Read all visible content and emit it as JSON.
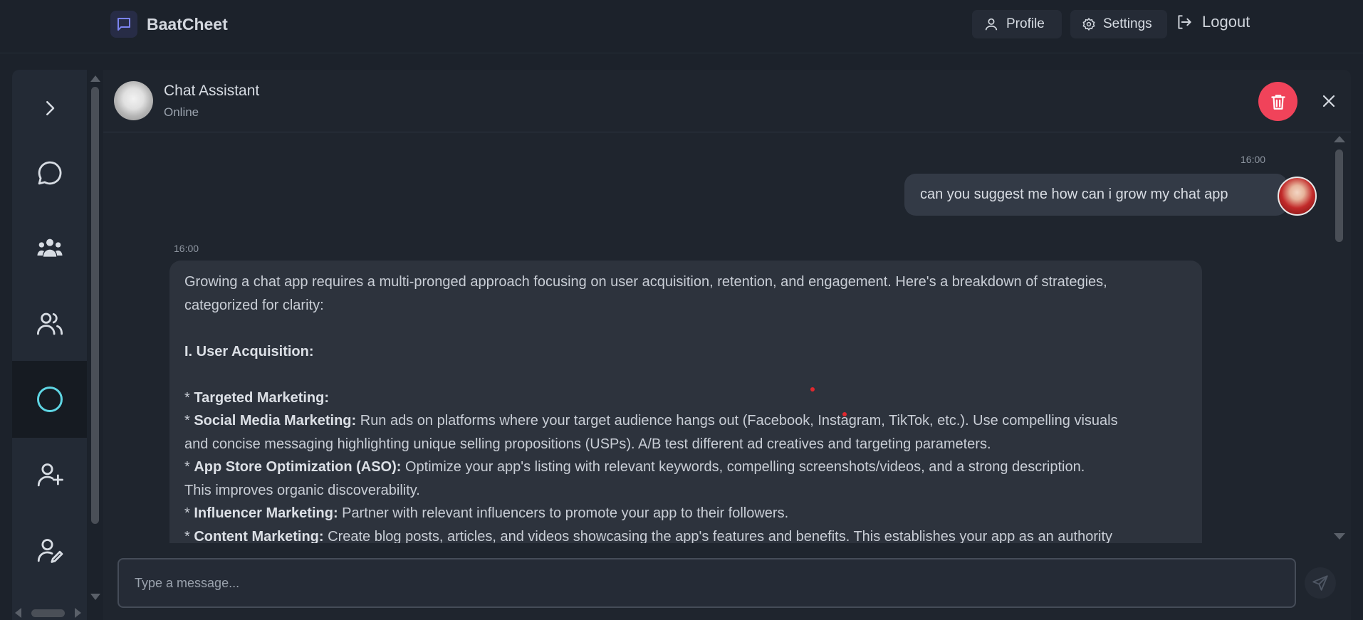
{
  "app": {
    "brand_name": "BaatCheet"
  },
  "nav": {
    "profile_label": "Profile",
    "settings_label": "Settings",
    "logout_label": "Logout"
  },
  "sidebar": {
    "items": [
      {
        "icon": "chevron-right-icon"
      },
      {
        "icon": "chat-bubble-icon"
      },
      {
        "icon": "group-icon"
      },
      {
        "icon": "users-icon"
      },
      {
        "icon": "circle-icon",
        "active": true
      },
      {
        "icon": "add-user-icon"
      },
      {
        "icon": "user-edit-icon"
      }
    ]
  },
  "chat": {
    "title": "Chat Assistant",
    "status": "Online",
    "messages": {
      "user_time": "16:00",
      "user_text": "can you suggest me how can i grow my chat app",
      "bot_time": "16:00",
      "bot_lines": [
        {
          "text": "Growing a chat app requires a multi-pronged approach focusing on user acquisition, retention, and engagement. Here's a breakdown of strategies,"
        },
        {
          "text": "categorized for clarity:"
        },
        {
          "text": ""
        },
        {
          "bold": "I. User Acquisition:"
        },
        {
          "text": ""
        },
        {
          "prefix": "* ",
          "bold": "Targeted Marketing:"
        },
        {
          "prefix": "* ",
          "bold": "Social Media Marketing:",
          "text": " Run ads on platforms where your target audience hangs out (Facebook, Instagram, TikTok, etc.). Use compelling visuals"
        },
        {
          "text": "and concise messaging highlighting unique selling propositions (USPs). A/B test different ad creatives and targeting parameters."
        },
        {
          "prefix": "* ",
          "bold": "App Store Optimization (ASO):",
          "text": " Optimize your app's listing with relevant keywords, compelling screenshots/videos, and a strong description."
        },
        {
          "text": "This improves organic discoverability."
        },
        {
          "prefix": "* ",
          "bold": "Influencer Marketing:",
          "text": " Partner with relevant influencers to promote your app to their followers."
        },
        {
          "prefix": "* ",
          "bold": "Content Marketing:",
          "text": " Create blog posts, articles, and videos showcasing the app's features and benefits. This establishes your app as an authority"
        }
      ]
    },
    "composer": {
      "placeholder": "Type a message..."
    }
  },
  "colors": {
    "accent_delete": "#f0435a",
    "brand_logo_bg": "#272c46",
    "brand_icon": "#7b83f0",
    "active_circle": "#5fd6e4"
  }
}
